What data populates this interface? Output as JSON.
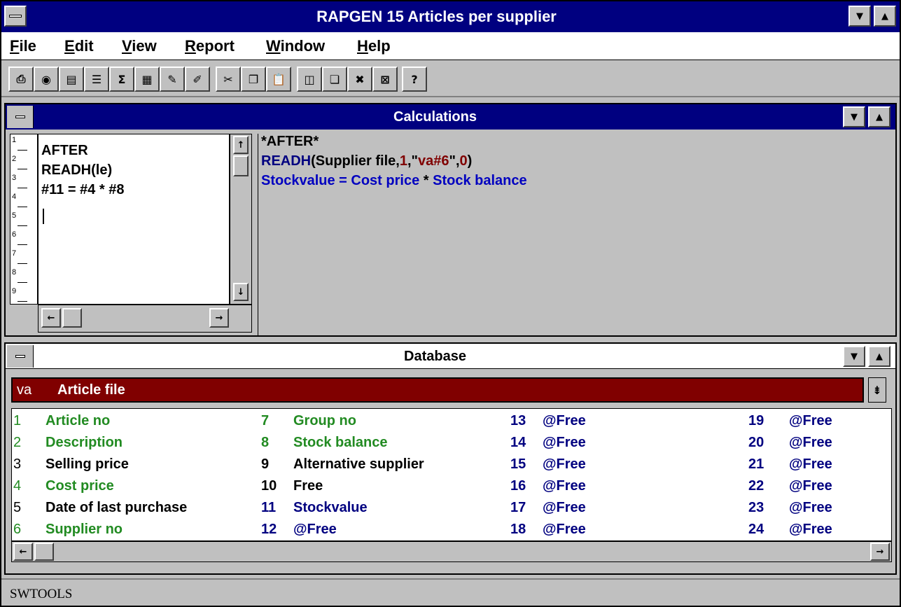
{
  "window": {
    "title": "RAPGEN 15 Articles per supplier"
  },
  "menu": [
    {
      "underline": "F",
      "rest": "ile"
    },
    {
      "underline": "E",
      "rest": "dit"
    },
    {
      "underline": "V",
      "rest": "iew"
    },
    {
      "underline": "R",
      "rest": "eport"
    },
    {
      "underline": "W",
      "rest": "indow"
    },
    {
      "underline": "H",
      "rest": "elp"
    }
  ],
  "toolbar": {
    "tools": [
      {
        "name": "print-icon",
        "glyph": "⎙"
      },
      {
        "name": "record-icon",
        "glyph": "◉"
      },
      {
        "name": "field-icon",
        "glyph": "▤"
      },
      {
        "name": "list-icon",
        "glyph": "☰"
      },
      {
        "name": "sum-icon",
        "glyph": "Σ"
      },
      {
        "name": "calculator-icon",
        "glyph": "▦"
      },
      {
        "name": "edit-form-icon",
        "glyph": "✎"
      },
      {
        "name": "pencil-icon",
        "glyph": "✐"
      },
      {
        "name": "cut-icon",
        "glyph": "✂"
      },
      {
        "name": "copy-icon",
        "glyph": "❐"
      },
      {
        "name": "paste-icon",
        "glyph": "📋"
      },
      {
        "name": "tile-icon",
        "glyph": "◫"
      },
      {
        "name": "cascade-icon",
        "glyph": "❏"
      },
      {
        "name": "delete-object-icon",
        "glyph": "✖"
      },
      {
        "name": "close-window-icon",
        "glyph": "⊠"
      },
      {
        "name": "help-icon",
        "glyph": "?"
      }
    ]
  },
  "calculations": {
    "title": "Calculations",
    "line_numbers": [
      "1",
      "2",
      "3",
      "4",
      "5",
      "6",
      "7",
      "8",
      "9"
    ],
    "editor_lines": [
      "AFTER",
      "READH(le)",
      "#11 = #4 * #8"
    ],
    "preview_line1": "*AFTER*",
    "preview_line2": {
      "fn": "READH",
      "open": "(Supplier file,",
      "num1": "1",
      "comma1": ",\"",
      "str": "va#6",
      "quote": "\",",
      "num2": "0",
      "close": ")"
    },
    "preview_line3": {
      "lhs": "Stockvalue = Cost price ",
      "op": "*",
      "rhs": " Stock balance"
    }
  },
  "database": {
    "title": "Database",
    "file_prefix": "va",
    "file_name": "Article file",
    "fields": [
      {
        "num": "1",
        "name": "Article no",
        "color": "#228b22",
        "numcolor": "#228b22"
      },
      {
        "num": "2",
        "name": "Description",
        "color": "#228b22",
        "numcolor": "#228b22"
      },
      {
        "num": "3",
        "name": "Selling price",
        "color": "#000000",
        "numcolor": "#000000"
      },
      {
        "num": "4",
        "name": "Cost price",
        "color": "#228b22",
        "numcolor": "#228b22"
      },
      {
        "num": "5",
        "name": "Date of last purchase",
        "color": "#000000",
        "numcolor": "#000000"
      },
      {
        "num": "6",
        "name": "Supplier no",
        "color": "#228b22",
        "numcolor": "#228b22"
      },
      {
        "num": "7",
        "name": "Group no",
        "color": "#228b22",
        "numcolor": "#228b22"
      },
      {
        "num": "8",
        "name": "Stock balance",
        "color": "#228b22",
        "numcolor": "#228b22"
      },
      {
        "num": "9",
        "name": "Alternative supplier",
        "color": "#000000",
        "numcolor": "#000000"
      },
      {
        "num": "10",
        "name": "Free",
        "color": "#000000",
        "numcolor": "#000000"
      },
      {
        "num": "11",
        "name": "Stockvalue",
        "color": "#000080",
        "numcolor": "#000080"
      },
      {
        "num": "12",
        "name": "@Free",
        "color": "#000080",
        "numcolor": "#000080"
      },
      {
        "num": "13",
        "name": "@Free",
        "color": "#000080",
        "numcolor": "#000080"
      },
      {
        "num": "14",
        "name": "@Free",
        "color": "#000080",
        "numcolor": "#000080"
      },
      {
        "num": "15",
        "name": "@Free",
        "color": "#000080",
        "numcolor": "#000080"
      },
      {
        "num": "16",
        "name": "@Free",
        "color": "#000080",
        "numcolor": "#000080"
      },
      {
        "num": "17",
        "name": "@Free",
        "color": "#000080",
        "numcolor": "#000080"
      },
      {
        "num": "18",
        "name": "@Free",
        "color": "#000080",
        "numcolor": "#000080"
      },
      {
        "num": "19",
        "name": "@Free",
        "color": "#000080",
        "numcolor": "#000080"
      },
      {
        "num": "20",
        "name": "@Free",
        "color": "#000080",
        "numcolor": "#000080"
      },
      {
        "num": "21",
        "name": "@Free",
        "color": "#000080",
        "numcolor": "#000080"
      },
      {
        "num": "22",
        "name": "@Free",
        "color": "#000080",
        "numcolor": "#000080"
      },
      {
        "num": "23",
        "name": "@Free",
        "color": "#000080",
        "numcolor": "#000080"
      },
      {
        "num": "24",
        "name": "@Free",
        "color": "#000080",
        "numcolor": "#000080"
      }
    ]
  },
  "status": {
    "text": "SWTOOLS"
  },
  "colors": {
    "title_active": "#000080",
    "face": "#c0c0c0",
    "file_bar": "#800000",
    "code_blue": "#000080",
    "code_red": "#800000",
    "field_green": "#228b22"
  }
}
